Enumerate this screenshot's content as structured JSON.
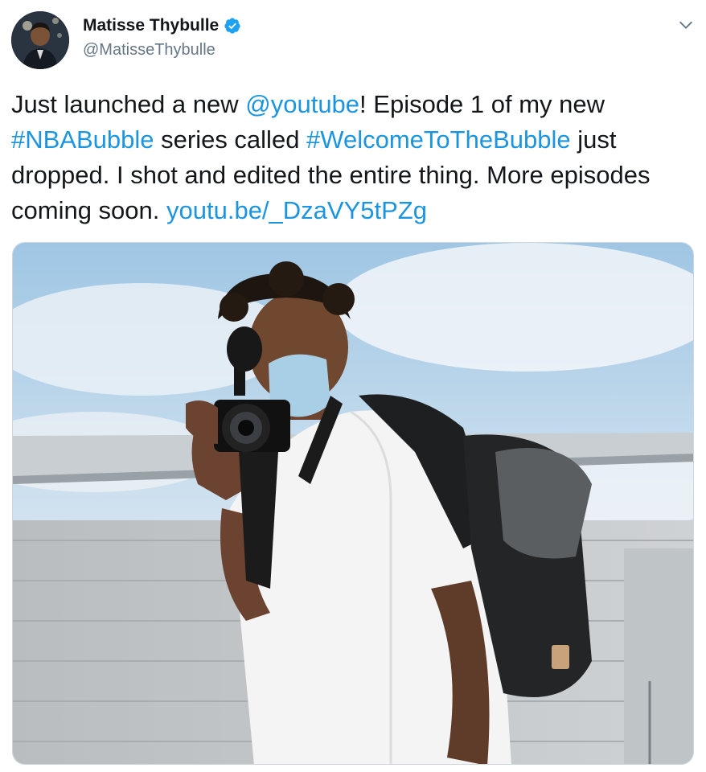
{
  "tweet": {
    "display_name": "Matisse Thybulle",
    "handle": "@MatisseThybulle",
    "verified_icon": "verified-badge-icon",
    "menu_icon": "chevron-down-icon",
    "text": {
      "t1": "Just launched a new ",
      "mention": "@youtube",
      "t2": "! Episode 1 of my new ",
      "hashtag1": "#NBABubble",
      "t3": " series called ",
      "hashtag2": "#WelcomeToTheBubble",
      "t4": " just dropped. I shot and edited the entire thing. More episodes coming soon. ",
      "url": "youtu.be/_DzaVY5tPZg"
    },
    "colors": {
      "link": "#1b95e0",
      "text": "#14171a",
      "secondary": "#657786",
      "verified": "#1da1f2"
    }
  }
}
